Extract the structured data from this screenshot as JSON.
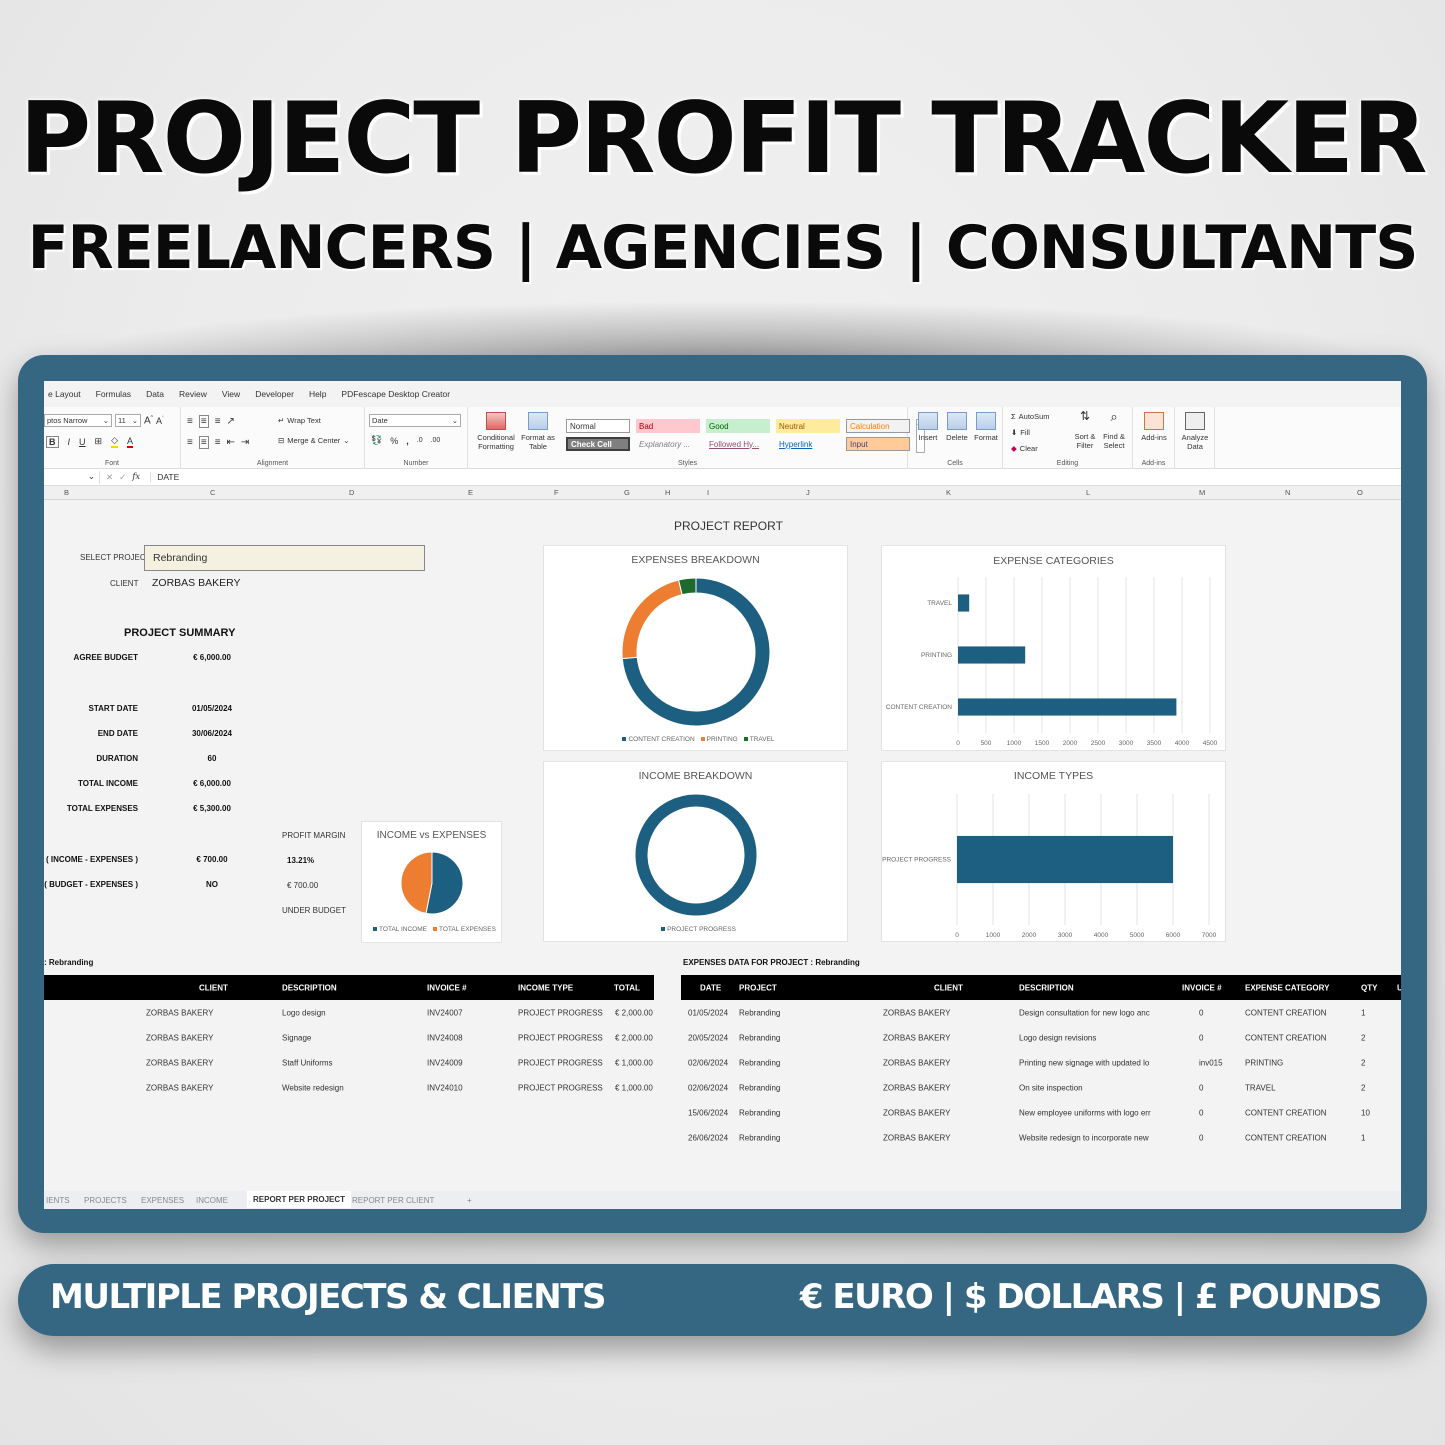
{
  "banner": {
    "title": "PROJECT PROFIT TRACKER",
    "subtitle": "FREELANCERS | AGENCIES | CONSULTANTS",
    "bottom_left": "MULTIPLE PROJECTS & CLIENTS",
    "bottom_right": "€ EURO  |  $ DOLLARS  |  £ POUNDS",
    "accent_color": "#356682"
  },
  "excel": {
    "menu": [
      "e Layout",
      "Formulas",
      "Data",
      "Review",
      "View",
      "Developer",
      "Help",
      "PDFescape Desktop Creator"
    ],
    "ribbon": {
      "font_name": "ptos Narrow",
      "font_size": "11",
      "font_group": "Font",
      "wrap_text": "Wrap Text",
      "merge_center": "Merge & Center",
      "alignment_group": "Alignment",
      "number_format": "Date",
      "number_group": "Number",
      "conditional_formatting": "Conditional Formatting",
      "format_as_table": "Format as Table",
      "styles": [
        {
          "label": "Normal",
          "bg": "#ffffff",
          "fg": "#333333"
        },
        {
          "label": "Bad",
          "bg": "#ffc7ce",
          "fg": "#9c0006"
        },
        {
          "label": "Good",
          "bg": "#c6efce",
          "fg": "#006100"
        },
        {
          "label": "Neutral",
          "bg": "#ffeb9c",
          "fg": "#9c5700"
        },
        {
          "label": "Calculation",
          "bg": "#f2f2f2",
          "fg": "#fa7d00"
        },
        {
          "label": "Check Cell",
          "bg": "#7f7f7f",
          "fg": "#ffffff"
        },
        {
          "label": "Explanatory ...",
          "bg": "transparent",
          "fg": "#7f7f7f"
        },
        {
          "label": "Followed Hy...",
          "bg": "transparent",
          "fg": "#954f72"
        },
        {
          "label": "Hyperlink",
          "bg": "transparent",
          "fg": "#0563c1"
        },
        {
          "label": "Input",
          "bg": "#ffcc99",
          "fg": "#3f3f76"
        }
      ],
      "styles_group": "Styles",
      "insert": "Insert",
      "delete": "Delete",
      "format": "Format",
      "cells_group": "Cells",
      "autosum": "AutoSum",
      "fill": "Fill",
      "clear": "Clear",
      "sort_filter": "Sort & Filter",
      "find_select": "Find & Select",
      "editing_group": "Editing",
      "add_ins": "Add-ins",
      "add_ins_group": "Add-ins",
      "analyze_data": "Analyze Data"
    },
    "formula_bar": {
      "fx": "fx",
      "content": "DATE"
    },
    "columns": [
      "B",
      "C",
      "D",
      "E",
      "F",
      "G",
      "H",
      "I",
      "J",
      "K",
      "L",
      "M",
      "N",
      "O"
    ],
    "sheet_tabs": [
      "IENTS",
      "PROJECTS",
      "EXPENSES",
      "INCOME",
      "REPORT PER PROJECT",
      "REPORT PER CLIENT",
      "+"
    ],
    "active_tab": "REPORT PER PROJECT"
  },
  "report": {
    "title": "PROJECT REPORT",
    "select_project_label": "SELECT PROJECT",
    "select_project_value": "Rebranding",
    "client_label": "CLIENT",
    "client_value": "ZORBAS BAKERY",
    "summary_title": "PROJECT SUMMARY",
    "summary": [
      {
        "label": "AGREE BUDGET",
        "value": "€ 6,000.00"
      },
      {
        "label": "START DATE",
        "value": "01/05/2024"
      },
      {
        "label": "END DATE",
        "value": "30/06/2024"
      },
      {
        "label": "DURATION",
        "value": "60"
      },
      {
        "label": "TOTAL INCOME",
        "value": "€ 6,000.00"
      },
      {
        "label": "TOTAL EXPENSES",
        "value": "€ 5,300.00"
      },
      {
        "label": "( INCOME - EXPENSES )",
        "value": "€ 700.00"
      },
      {
        "label": "( BUDGET - EXPENSES )",
        "value": "NO"
      }
    ],
    "profit_margin_label": "PROFIT MARGIN",
    "profit_margin_value": "13.21%",
    "budget_diff_value": "€ 700.00",
    "budget_status": "UNDER BUDGET",
    "income_table_title": ": Rebranding",
    "income_table": {
      "headers": [
        "CLIENT",
        "DESCRIPTION",
        "INVOICE #",
        "INCOME TYPE",
        "TOTAL"
      ],
      "rows": [
        [
          "ZORBAS BAKERY",
          "Logo design",
          "INV24007",
          "PROJECT PROGRESS",
          "€ 2,000.00"
        ],
        [
          "ZORBAS BAKERY",
          "Signage",
          "INV24008",
          "PROJECT PROGRESS",
          "€ 2,000.00"
        ],
        [
          "ZORBAS BAKERY",
          "Staff Uniforms",
          "INV24009",
          "PROJECT PROGRESS",
          "€ 1,000.00"
        ],
        [
          "ZORBAS BAKERY",
          "Website redesign",
          "INV24010",
          "PROJECT PROGRESS",
          "€ 1,000.00"
        ]
      ]
    },
    "expenses_table_title": "EXPENSES DATA FOR PROJECT : Rebranding",
    "expenses_table": {
      "headers": [
        "DATE",
        "PROJECT",
        "CLIENT",
        "DESCRIPTION",
        "INVOICE #",
        "EXPENSE CATEGORY",
        "QTY",
        "U"
      ],
      "rows": [
        [
          "01/05/2024",
          "Rebranding",
          "ZORBAS BAKERY",
          "Design consultation for new logo anc",
          "0",
          "CONTENT CREATION",
          "1"
        ],
        [
          "20/05/2024",
          "Rebranding",
          "ZORBAS BAKERY",
          "Logo design revisions",
          "0",
          "CONTENT CREATION",
          "2"
        ],
        [
          "02/06/2024",
          "Rebranding",
          "ZORBAS BAKERY",
          "Printing new signage with updated lo",
          "inv015",
          "PRINTING",
          "2"
        ],
        [
          "02/06/2024",
          "Rebranding",
          "ZORBAS BAKERY",
          "On site inspection",
          "0",
          "TRAVEL",
          "2"
        ],
        [
          "15/06/2024",
          "Rebranding",
          "ZORBAS BAKERY",
          "New employee uniforms with logo err",
          "0",
          "CONTENT CREATION",
          "10"
        ],
        [
          "26/06/2024",
          "Rebranding",
          "ZORBAS BAKERY",
          "Website redesign to incorporate new",
          "0",
          "CONTENT CREATION",
          "1"
        ]
      ]
    }
  },
  "chart_data": [
    {
      "id": "expenses-breakdown",
      "type": "pie",
      "donut": true,
      "title": "EXPENSES BREAKDOWN",
      "categories": [
        "CONTENT CREATION",
        "PRINTING",
        "TRAVEL"
      ],
      "values": [
        3900,
        1200,
        200
      ],
      "colors": [
        "#1d5f80",
        "#ed7d31",
        "#1e6b2e"
      ],
      "legend": "bottom"
    },
    {
      "id": "expense-categories",
      "type": "bar",
      "orientation": "horizontal",
      "title": "EXPENSE CATEGORIES",
      "categories": [
        "TRAVEL",
        "PRINTING",
        "CONTENT CREATION"
      ],
      "values": [
        200,
        1200,
        3900
      ],
      "xlim": [
        0,
        4500
      ],
      "ticks": [
        0,
        500,
        1000,
        1500,
        2000,
        2500,
        3000,
        3500,
        4000,
        4500
      ],
      "grid": true,
      "color": "#1d5f80"
    },
    {
      "id": "income-vs-expenses",
      "type": "pie",
      "title": "INCOME vs EXPENSES",
      "categories": [
        "TOTAL INCOME",
        "TOTAL EXPENSES"
      ],
      "values": [
        6000,
        5300
      ],
      "colors": [
        "#1d5f80",
        "#ed7d31"
      ],
      "legend": "bottom"
    },
    {
      "id": "income-breakdown",
      "type": "pie",
      "donut": true,
      "title": "INCOME BREAKDOWN",
      "categories": [
        "PROJECT PROGRESS"
      ],
      "values": [
        6000
      ],
      "colors": [
        "#1d5f80"
      ],
      "legend": "bottom"
    },
    {
      "id": "income-types",
      "type": "bar",
      "orientation": "horizontal",
      "title": "INCOME TYPES",
      "categories": [
        "PROJECT PROGRESS"
      ],
      "values": [
        6000
      ],
      "xlim": [
        0,
        7000
      ],
      "ticks": [
        0,
        1000,
        2000,
        3000,
        4000,
        5000,
        6000,
        7000
      ],
      "grid": true,
      "color": "#1d5f80"
    }
  ]
}
